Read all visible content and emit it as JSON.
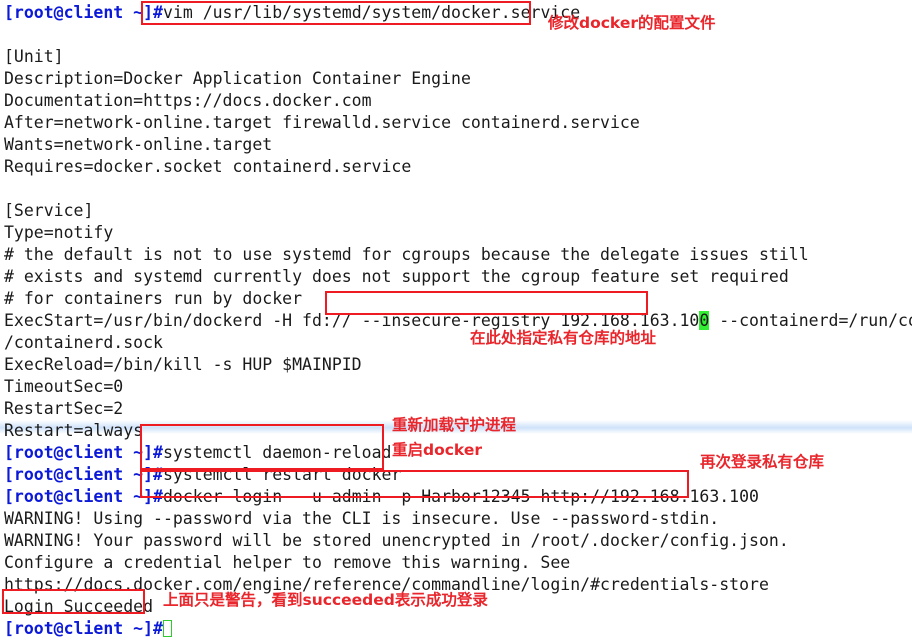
{
  "terminal": {
    "prompt": "[root@client ~]",
    "hash": "#",
    "lines": [
      {
        "type": "prompt",
        "command": "vim /usr/lib/systemd/system/docker.service"
      },
      {
        "type": "blank",
        "text": ""
      },
      {
        "type": "out",
        "text": "[Unit]"
      },
      {
        "type": "out",
        "text": "Description=Docker Application Container Engine"
      },
      {
        "type": "out",
        "text": "Documentation=https://docs.docker.com"
      },
      {
        "type": "out",
        "text": "After=network-online.target firewalld.service containerd.service"
      },
      {
        "type": "out",
        "text": "Wants=network-online.target"
      },
      {
        "type": "out",
        "text": "Requires=docker.socket containerd.service"
      },
      {
        "type": "blank",
        "text": ""
      },
      {
        "type": "out",
        "text": "[Service]"
      },
      {
        "type": "out",
        "text": "Type=notify"
      },
      {
        "type": "out",
        "text": "# the default is not to use systemd for cgroups because the delegate issues still"
      },
      {
        "type": "out",
        "text": "# exists and systemd currently does not support the cgroup feature set required"
      },
      {
        "type": "out",
        "text": "# for containers run by docker"
      },
      {
        "type": "out_cursor",
        "pre": "ExecStart=/usr/bin/dockerd -H fd:// --insecure-registry 192.168.163.10",
        "cursor": "0",
        "post": " --containerd=/run/containerd"
      },
      {
        "type": "out",
        "text": "/containerd.sock"
      },
      {
        "type": "out",
        "text": "ExecReload=/bin/kill -s HUP $MAINPID"
      },
      {
        "type": "out",
        "text": "TimeoutSec=0"
      },
      {
        "type": "out",
        "text": "RestartSec=2"
      },
      {
        "type": "out",
        "text": "Restart=always"
      },
      {
        "type": "prompt",
        "command": "systemctl daemon-reload"
      },
      {
        "type": "prompt",
        "command": "systemctl restart docker"
      },
      {
        "type": "prompt",
        "command": "docker login  -u admin -p Harbor12345 http://192.168.163.100"
      },
      {
        "type": "out",
        "text": "WARNING! Using --password via the CLI is insecure. Use --password-stdin."
      },
      {
        "type": "out",
        "text": "WARNING! Your password will be stored unencrypted in /root/.docker/config.json."
      },
      {
        "type": "out",
        "text": "Configure a credential helper to remove this warning. See"
      },
      {
        "type": "out",
        "text": "https://docs.docker.com/engine/reference/commandline/login/#credentials-store"
      },
      {
        "type": "blank",
        "text": ""
      },
      {
        "type": "out",
        "text": "Login Succeeded"
      },
      {
        "type": "prompt_cursor",
        "command": ""
      }
    ]
  },
  "annotations": {
    "notes": [
      {
        "id": "note-modify-config",
        "text": "修改docker的配置文件"
      },
      {
        "id": "note-specify-registry",
        "text": "在此处指定私有仓库的地址"
      },
      {
        "id": "note-reload-daemon",
        "text": "重新加载守护进程"
      },
      {
        "id": "note-restart-docker",
        "text": "重启docker"
      },
      {
        "id": "note-login-again",
        "text": "再次登录私有仓库"
      },
      {
        "id": "note-warning-explain",
        "text": "上面只是警告，看到succeeded表示成功登录"
      }
    ],
    "box_color": "#ee1c22",
    "note_color": "#e8262c",
    "cursor_color": "#33ef33",
    "prompt_color": "#0b19d8"
  }
}
